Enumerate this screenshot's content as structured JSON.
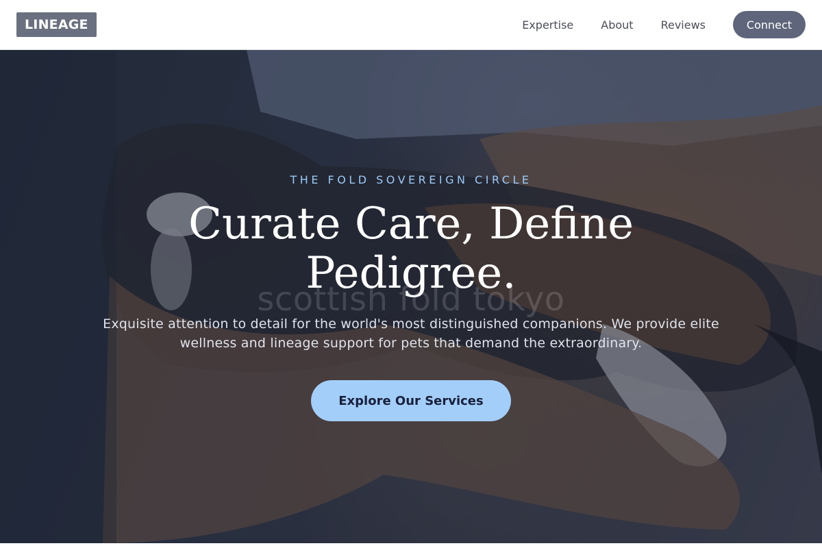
{
  "header": {
    "logo": "LINEAGE",
    "nav": [
      {
        "label": "Expertise"
      },
      {
        "label": "About"
      },
      {
        "label": "Reviews"
      }
    ],
    "connect_label": "Connect"
  },
  "hero": {
    "eyebrow": "THE FOLD SOVEREIGN CIRCLE",
    "headline_line1": "Curate Care, Define",
    "headline_line2": "Pedigree.",
    "watermark": "scottish fold tokyo",
    "subtext": "Exquisite attention to detail for the world's most distinguished companions. We provide elite wellness and lineage support for pets that demand the extraordinary.",
    "cta_label": "Explore Our Services",
    "image_subject": "cat-held-in-hands-photo"
  },
  "colors": {
    "logo_bg": "#6b7080",
    "connect_bg": "#5f667c",
    "eyebrow": "#9ccaf6",
    "cta_bg": "#a3cefa",
    "cta_text": "#18203a"
  }
}
